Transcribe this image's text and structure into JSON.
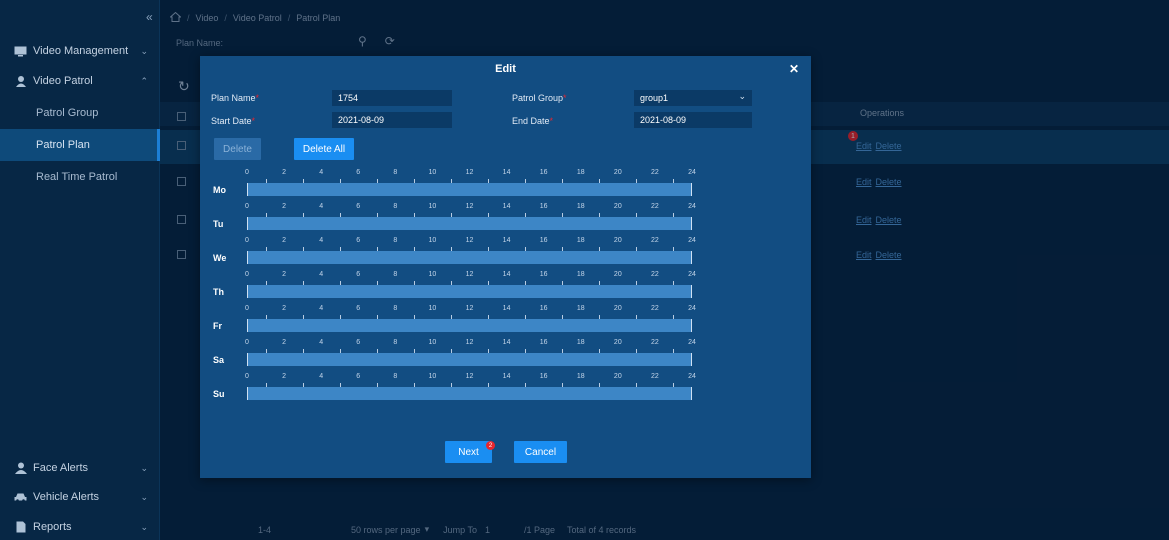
{
  "sidebar": {
    "collapse_icon": "collapse-left-icon",
    "groups": {
      "video_management": "Video Management",
      "video_patrol": "Video Patrol",
      "face_alerts": "Face Alerts",
      "vehicle_alerts": "Vehicle Alerts",
      "reports": "Reports"
    },
    "items": {
      "patrol_group": "Patrol Group",
      "patrol_plan": "Patrol Plan",
      "real_time_patrol": "Real Time Patrol"
    }
  },
  "breadcrumb": {
    "video": "Video",
    "video_patrol": "Video Patrol",
    "patrol_plan": "Patrol Plan",
    "separator": "/"
  },
  "filter": {
    "plan_name_label": "Plan Name:"
  },
  "table": {
    "operations_header": "Operations",
    "edit_label": "Edit",
    "delete_label": "Delete",
    "badge_1": "1"
  },
  "pager": {
    "range": "1-4",
    "rows_per_page": "50 rows per page",
    "jump_to": "Jump To",
    "jump_value": "1",
    "page": "/1 Page",
    "total": "Total of 4 records"
  },
  "modal": {
    "title": "Edit",
    "plan_name_label": "Plan Name",
    "plan_name_value": "1754",
    "patrol_group_label": "Patrol Group",
    "patrol_group_value": "group1",
    "start_date_label": "Start Date",
    "start_date_value": "2021-08-09",
    "end_date_label": "End Date",
    "end_date_value": "2021-08-09",
    "required_mark": "*",
    "delete_label": "Delete",
    "delete_all_label": "Delete All",
    "next_label": "Next",
    "cancel_label": "Cancel",
    "badge_2": "2",
    "hours": [
      "0",
      "2",
      "4",
      "6",
      "8",
      "10",
      "12",
      "14",
      "16",
      "18",
      "20",
      "22",
      "24"
    ],
    "days": [
      "Mo",
      "Tu",
      "We",
      "Th",
      "Fr",
      "Sa",
      "Su"
    ]
  },
  "colors": {
    "background": "#062544",
    "modal": "#124d82",
    "accent": "#1a8ef2",
    "badge": "#e8262e",
    "link": "#4f96d8"
  }
}
